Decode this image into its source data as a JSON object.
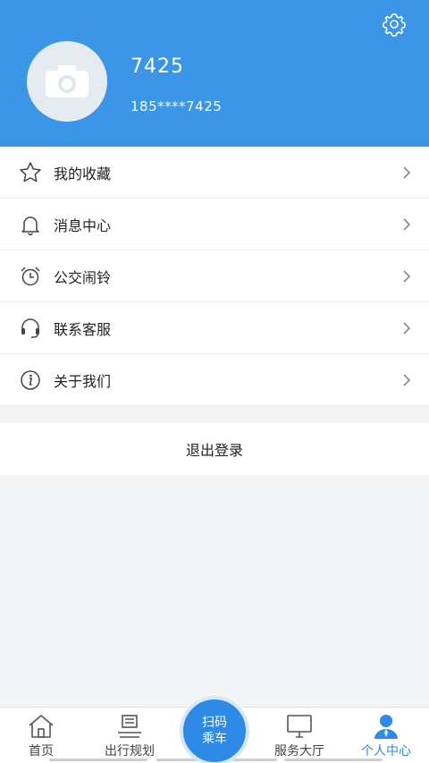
{
  "profile": {
    "username": "7425",
    "phone": "185****7425"
  },
  "menu": {
    "items": [
      {
        "label": "我的收藏",
        "icon": "star-icon"
      },
      {
        "label": "消息中心",
        "icon": "bell-icon"
      },
      {
        "label": "公交闹铃",
        "icon": "alarm-clock-icon"
      },
      {
        "label": "联系客服",
        "icon": "headset-icon"
      },
      {
        "label": "关于我们",
        "icon": "info-icon"
      }
    ]
  },
  "logout": {
    "label": "退出登录"
  },
  "tabbar": {
    "home": "首页",
    "trip": "出行规划",
    "scan_line1": "扫码",
    "scan_line2": "乘车",
    "service": "服务大厅",
    "me": "个人中心"
  },
  "colors": {
    "header_bg": "#3c96e8",
    "accent": "#2d8ae6"
  }
}
